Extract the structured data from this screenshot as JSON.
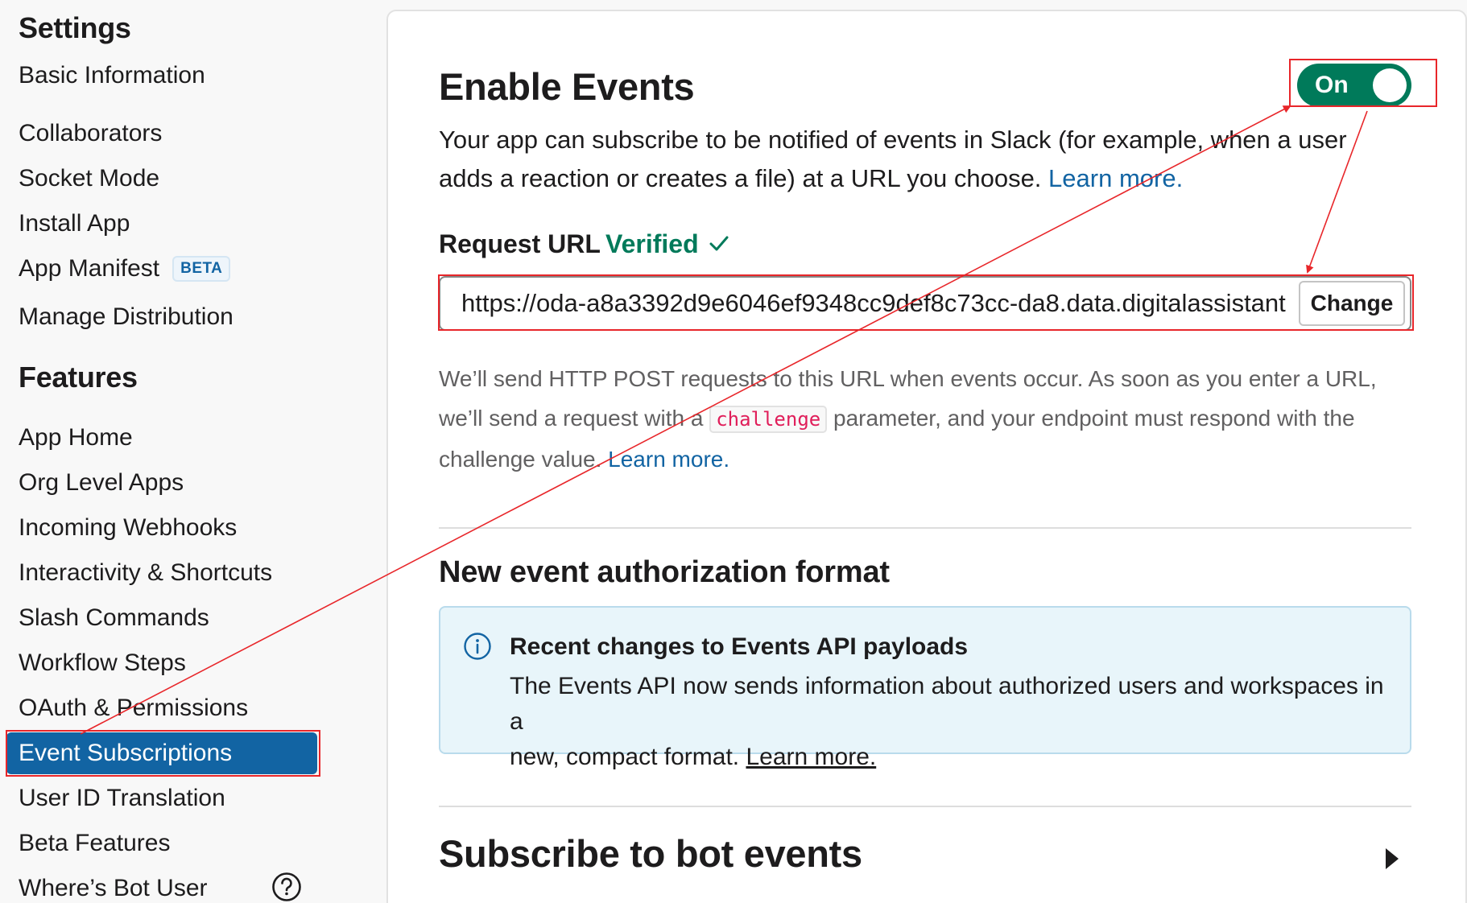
{
  "sidebar": {
    "settings_title": "Settings",
    "settings_items": [
      {
        "label": "Basic Information"
      },
      {
        "label": "Collaborators"
      },
      {
        "label": "Socket Mode"
      },
      {
        "label": "Install App"
      },
      {
        "label": "App Manifest",
        "badge": "BETA"
      },
      {
        "label": "Manage Distribution"
      }
    ],
    "features_title": "Features",
    "features_items": [
      {
        "label": "App Home"
      },
      {
        "label": "Org Level Apps"
      },
      {
        "label": "Incoming Webhooks"
      },
      {
        "label": "Interactivity & Shortcuts"
      },
      {
        "label": "Slash Commands"
      },
      {
        "label": "Workflow Steps"
      },
      {
        "label": "OAuth & Permissions"
      },
      {
        "label": "Event Subscriptions",
        "active": true
      },
      {
        "label": "User ID Translation"
      },
      {
        "label": "Beta Features"
      },
      {
        "label": "Where’s Bot User"
      }
    ],
    "help_icon": "question-circle-icon"
  },
  "enable_events": {
    "title": "Enable Events",
    "toggle_label": "On",
    "toggle_state": "on",
    "desc_line1": "Your app can subscribe to be notified of events in Slack (for example, when a user",
    "desc_line2": "adds a reaction or creates a file) at a URL you choose.",
    "desc_link": "Learn more."
  },
  "request_url": {
    "label": "Request URL",
    "status": "Verified",
    "status_icon": "checkmark-icon",
    "value": "https://oda-a8a3392d9e6046ef9348cc9def8c73cc-da8.data.digitalassistant",
    "change_label": "Change",
    "help_line1": "We’ll send HTTP POST requests to this URL when events occur. As soon as you enter a URL,",
    "help_line2_pre": "we’ll send a request with a",
    "help_code": "challenge",
    "help_line2_post": "parameter, and your endpoint must respond with the",
    "help_line3": "challenge value.",
    "help_link": "Learn more."
  },
  "auth_format": {
    "title": "New event authorization format",
    "info_icon": "info-circle-icon",
    "info_title": "Recent changes to Events API payloads",
    "info_line1": "The Events API now sends information about authorized users and workspaces in a",
    "info_line2": "new, compact format.",
    "info_link": "Learn more."
  },
  "bot_events": {
    "title": "Subscribe to bot events",
    "expand_icon": "caret-right-icon"
  },
  "colors": {
    "accent": "#1264a3",
    "toggle_on": "#007a5a",
    "verified": "#007a5a",
    "annotation": "#e8262a"
  }
}
